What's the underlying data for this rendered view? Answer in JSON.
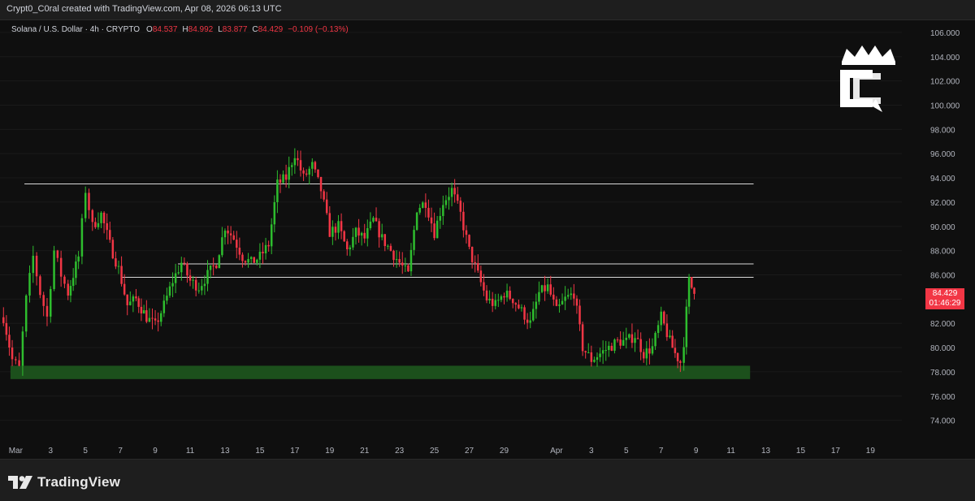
{
  "header": {
    "attribution": "Crypt0_C0ral created with TradingView.com, Apr 08, 2026 06:13 UTC"
  },
  "legend": {
    "symbol": "Solana / U.S. Dollar · 4h · CRYPTO",
    "o_label": "O",
    "o_value": "84.537",
    "h_label": "H",
    "h_value": "84.992",
    "l_label": "L",
    "l_value": "83.877",
    "c_label": "C",
    "c_value": "84.429",
    "change": "−0.109 (−0.13%)"
  },
  "price_tag": {
    "price": "84.429",
    "countdown": "01:46:29"
  },
  "footer": {
    "brand": "TradingView"
  },
  "colors": {
    "up": "#2ebd2e",
    "down": "#f23645",
    "zone": "#1e5c1e",
    "level": "#d9d9d9",
    "background": "#0f0f0f"
  },
  "chart_data": {
    "type": "candlestick",
    "title": "",
    "ylim": [
      72.5,
      107
    ],
    "y_ticks": [
      "74.000",
      "76.000",
      "78.000",
      "80.000",
      "82.000",
      "84.000",
      "86.000",
      "88.000",
      "90.000",
      "92.000",
      "94.000",
      "96.000",
      "98.000",
      "100.000",
      "102.000",
      "104.000",
      "106.000"
    ],
    "x_ticks": [
      "Mar",
      "3",
      "5",
      "7",
      "9",
      "11",
      "13",
      "15",
      "17",
      "19",
      "21",
      "23",
      "25",
      "27",
      "29",
      "Apr",
      "3",
      "5",
      "7",
      "9",
      "11",
      "13",
      "15",
      "17",
      "19"
    ],
    "x_tick_days": [
      1,
      3,
      5,
      7,
      9,
      11,
      13,
      15,
      17,
      19,
      21,
      23,
      25,
      27,
      29,
      32,
      34,
      36,
      38,
      40,
      42,
      44,
      46,
      48,
      50
    ],
    "x_range": [
      0.1,
      51.8
    ],
    "levels": [
      {
        "price": 93.5,
        "from_day": 1.5,
        "to_day": 43.3
      },
      {
        "price": 86.9,
        "from_day": 10.3,
        "to_day": 43.3
      },
      {
        "price": 85.8,
        "from_day": 7.1,
        "to_day": 43.3
      }
    ],
    "support_zone": {
      "low": 77.4,
      "high": 78.5,
      "from_day": 0.7,
      "to_day": 43.1
    },
    "price_path": [
      [
        0.3,
        82.5
      ],
      [
        0.8,
        79.0
      ],
      [
        1.2,
        78.3
      ],
      [
        1.6,
        84.0
      ],
      [
        2.0,
        87.5
      ],
      [
        2.4,
        84.5
      ],
      [
        2.8,
        82.5
      ],
      [
        3.2,
        88.0
      ],
      [
        3.6,
        86.0
      ],
      [
        4.0,
        84.5
      ],
      [
        4.6,
        87.5
      ],
      [
        5.0,
        93.0
      ],
      [
        5.4,
        90.0
      ],
      [
        5.9,
        91.0
      ],
      [
        6.4,
        88.5
      ],
      [
        6.9,
        86.5
      ],
      [
        7.4,
        83.5
      ],
      [
        7.9,
        84.0
      ],
      [
        8.5,
        82.5
      ],
      [
        9.0,
        81.8
      ],
      [
        9.5,
        83.5
      ],
      [
        10.0,
        85.5
      ],
      [
        10.5,
        87.0
      ],
      [
        11.0,
        85.5
      ],
      [
        11.5,
        85.0
      ],
      [
        12.0,
        86.0
      ],
      [
        12.5,
        87.0
      ],
      [
        13.0,
        90.0
      ],
      [
        13.5,
        89.0
      ],
      [
        14.0,
        87.5
      ],
      [
        14.5,
        87.0
      ],
      [
        15.0,
        87.5
      ],
      [
        15.5,
        88.5
      ],
      [
        16.0,
        93.5
      ],
      [
        16.5,
        94.0
      ],
      [
        17.0,
        96.0
      ],
      [
        17.5,
        94.0
      ],
      [
        18.0,
        95.0
      ],
      [
        18.5,
        93.0
      ],
      [
        19.0,
        89.5
      ],
      [
        19.5,
        90.0
      ],
      [
        20.0,
        88.0
      ],
      [
        20.5,
        89.5
      ],
      [
        21.0,
        89.0
      ],
      [
        21.5,
        90.5
      ],
      [
        22.0,
        89.0
      ],
      [
        22.5,
        88.0
      ],
      [
        23.0,
        87.0
      ],
      [
        23.5,
        86.0
      ],
      [
        24.0,
        91.5
      ],
      [
        24.5,
        92.0
      ],
      [
        25.0,
        89.5
      ],
      [
        25.5,
        92.0
      ],
      [
        26.0,
        93.0
      ],
      [
        26.5,
        91.0
      ],
      [
        27.0,
        88.0
      ],
      [
        27.5,
        86.0
      ],
      [
        28.0,
        84.0
      ],
      [
        28.5,
        83.5
      ],
      [
        29.0,
        84.5
      ],
      [
        29.5,
        84.0
      ],
      [
        30.0,
        83.0
      ],
      [
        30.5,
        82.0
      ],
      [
        31.0,
        84.5
      ],
      [
        31.5,
        85.0
      ],
      [
        32.0,
        83.0
      ],
      [
        32.5,
        84.0
      ],
      [
        33.0,
        84.5
      ],
      [
        33.5,
        80.0
      ],
      [
        34.0,
        79.0
      ],
      [
        34.5,
        79.5
      ],
      [
        35.0,
        80.0
      ],
      [
        35.5,
        80.5
      ],
      [
        36.0,
        80.5
      ],
      [
        36.5,
        81.0
      ],
      [
        37.0,
        79.5
      ],
      [
        37.5,
        80.0
      ],
      [
        38.0,
        82.5
      ],
      [
        38.5,
        80.5
      ],
      [
        38.8,
        79.5
      ],
      [
        39.1,
        78.8
      ],
      [
        39.3,
        80.5
      ],
      [
        39.6,
        85.5
      ],
      [
        39.9,
        84.43
      ]
    ]
  }
}
